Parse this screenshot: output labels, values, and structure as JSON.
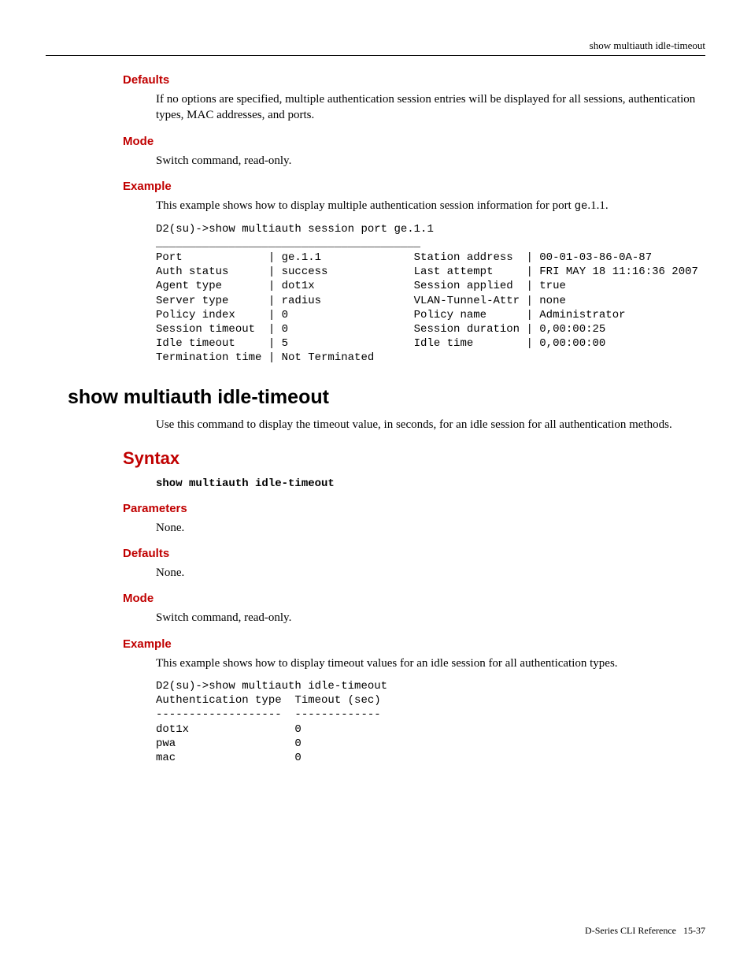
{
  "header": {
    "running_title": "show multiauth idle-timeout"
  },
  "sections1": {
    "defaults": {
      "title": "Defaults",
      "body": "If no options are specified, multiple authentication session entries will be displayed for all sessions, authentication types, MAC addresses, and ports."
    },
    "mode": {
      "title": "Mode",
      "body": "Switch command, read-only."
    },
    "example": {
      "title": "Example",
      "intro_before": "This example shows how to display multiple authentication session information for port ",
      "intro_code": "ge",
      "intro_after": ".1.1.",
      "code": "D2(su)->show multiauth session port ge.1.1\n________________________________________\nPort             | ge.1.1              Station address  | 00-01-03-86-0A-87\nAuth status      | success             Last attempt     | FRI MAY 18 11:16:36 2007\nAgent type       | dot1x               Session applied  | true\nServer type      | radius              VLAN-Tunnel-Attr | none\nPolicy index     | 0                   Policy name      | Administrator\nSession timeout  | 0                   Session duration | 0,00:00:25\nIdle timeout     | 5                   Idle time        | 0,00:00:00\nTermination time | Not Terminated"
    }
  },
  "command": {
    "title": "show multiauth idle-timeout",
    "description": "Use this command to display the timeout value, in seconds, for an idle session for all authentication methods."
  },
  "syntax": {
    "title": "Syntax",
    "code": "show multiauth idle-timeout"
  },
  "sections2": {
    "parameters": {
      "title": "Parameters",
      "body": "None."
    },
    "defaults": {
      "title": "Defaults",
      "body": "None."
    },
    "mode": {
      "title": "Mode",
      "body": "Switch command, read-only."
    },
    "example": {
      "title": "Example",
      "intro": "This example shows how to display timeout values for an idle session for all authentication types.",
      "code": "D2(su)->show multiauth idle-timeout\nAuthentication type  Timeout (sec)\n-------------------  -------------\ndot1x                0\npwa                  0\nmac                  0"
    }
  },
  "footer": {
    "left": "D-Series CLI Reference",
    "right": "15-37"
  }
}
